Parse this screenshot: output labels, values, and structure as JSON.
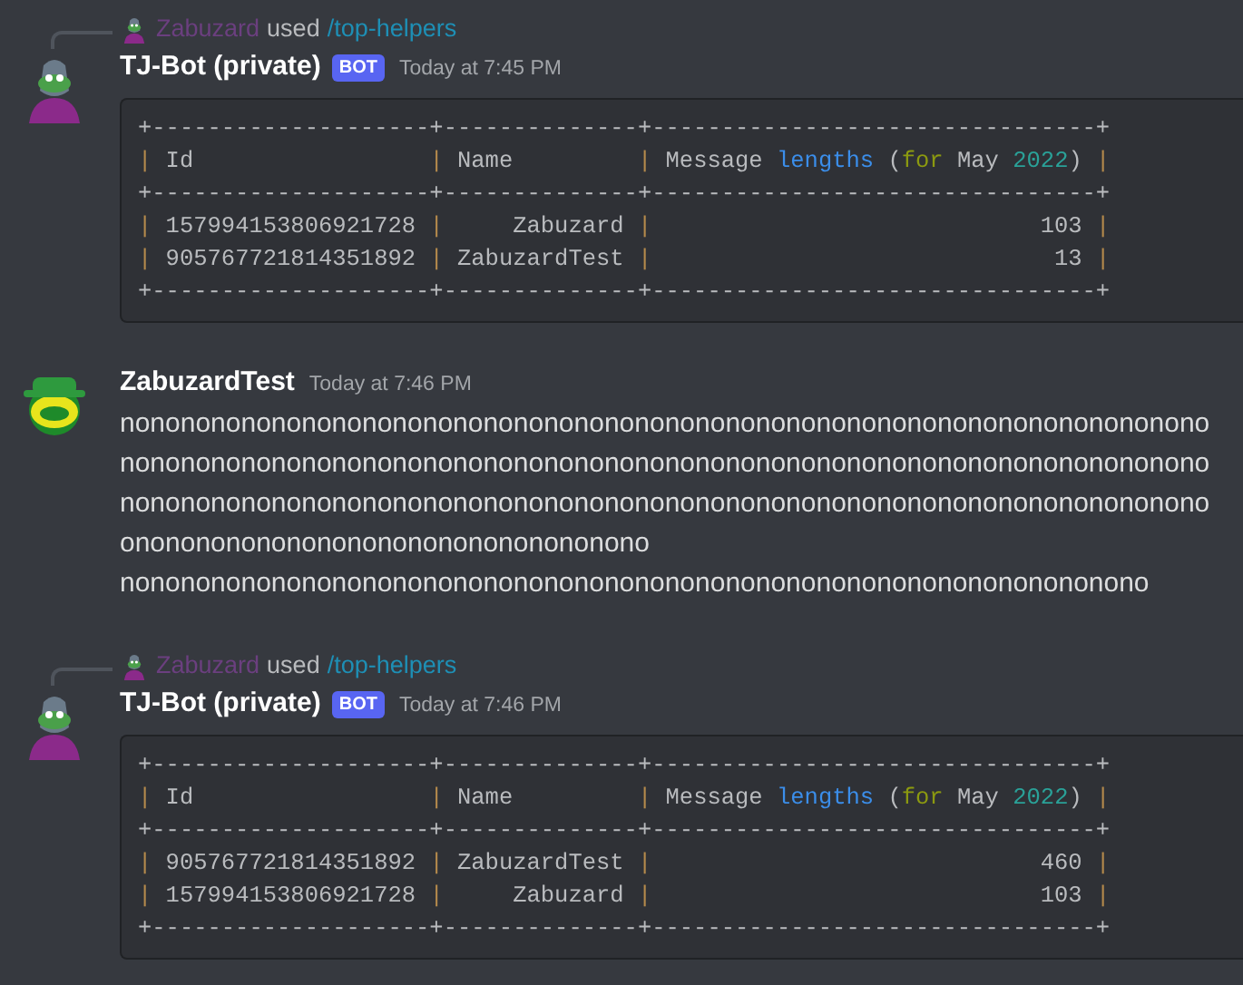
{
  "messages": [
    {
      "kind": "bot",
      "reply": {
        "user": "Zabuzard",
        "action": "used",
        "command": "/top-helpers"
      },
      "author": "TJ-Bot (private)",
      "tag": "BOT",
      "time": "Today at 7:45 PM",
      "code_lines": [
        [
          {
            "text": "+--------------------+--------------+--------------------------------+",
            "kind": "plain"
          }
        ],
        [
          {
            "text": "|",
            "kind": "pipe"
          },
          {
            "text": " Id                 ",
            "kind": "plain"
          },
          {
            "text": "|",
            "kind": "pipe"
          },
          {
            "text": " Name         ",
            "kind": "plain"
          },
          {
            "text": "|",
            "kind": "pipe"
          },
          {
            "text": " Message ",
            "kind": "plain"
          },
          {
            "text": "lengths",
            "kind": "function"
          },
          {
            "text": " (",
            "kind": "plain"
          },
          {
            "text": "for",
            "kind": "keyword"
          },
          {
            "text": " May ",
            "kind": "plain"
          },
          {
            "text": "2022",
            "kind": "number"
          },
          {
            "text": ") ",
            "kind": "plain"
          },
          {
            "text": "|",
            "kind": "pipe"
          }
        ],
        [
          {
            "text": "+--------------------+--------------+--------------------------------+",
            "kind": "plain"
          }
        ],
        [
          {
            "text": "|",
            "kind": "pipe"
          },
          {
            "text": " 157994153806921728 ",
            "kind": "plain"
          },
          {
            "text": "|",
            "kind": "pipe"
          },
          {
            "text": "     Zabuzard ",
            "kind": "plain"
          },
          {
            "text": "|",
            "kind": "pipe"
          },
          {
            "text": "                            103 ",
            "kind": "plain"
          },
          {
            "text": "|",
            "kind": "pipe"
          }
        ],
        [
          {
            "text": "|",
            "kind": "pipe"
          },
          {
            "text": " 905767721814351892 ",
            "kind": "plain"
          },
          {
            "text": "|",
            "kind": "pipe"
          },
          {
            "text": " ZabuzardTest ",
            "kind": "plain"
          },
          {
            "text": "|",
            "kind": "pipe"
          },
          {
            "text": "                             13 ",
            "kind": "plain"
          },
          {
            "text": "|",
            "kind": "pipe"
          }
        ],
        [
          {
            "text": "+--------------------+--------------+--------------------------------+",
            "kind": "plain"
          }
        ]
      ]
    },
    {
      "kind": "user",
      "author": "ZabuzardTest",
      "time": "Today at 7:46 PM",
      "text_lines": [
        "nononononononononononononononononononononononononononononononononononono",
        "nononononononononononononononononononononononononononononononononononono",
        "nononononononononononononononononononononononononononononononononononono",
        "ononononononononononononononononono",
        "nononononononononononononononononononononononononononononononononono"
      ]
    },
    {
      "kind": "bot",
      "reply": {
        "user": "Zabuzard",
        "action": "used",
        "command": "/top-helpers"
      },
      "author": "TJ-Bot (private)",
      "tag": "BOT",
      "time": "Today at 7:46 PM",
      "code_lines": [
        [
          {
            "text": "+--------------------+--------------+--------------------------------+",
            "kind": "plain"
          }
        ],
        [
          {
            "text": "|",
            "kind": "pipe"
          },
          {
            "text": " Id                 ",
            "kind": "plain"
          },
          {
            "text": "|",
            "kind": "pipe"
          },
          {
            "text": " Name         ",
            "kind": "plain"
          },
          {
            "text": "|",
            "kind": "pipe"
          },
          {
            "text": " Message ",
            "kind": "plain"
          },
          {
            "text": "lengths",
            "kind": "function"
          },
          {
            "text": " (",
            "kind": "plain"
          },
          {
            "text": "for",
            "kind": "keyword"
          },
          {
            "text": " May ",
            "kind": "plain"
          },
          {
            "text": "2022",
            "kind": "number"
          },
          {
            "text": ") ",
            "kind": "plain"
          },
          {
            "text": "|",
            "kind": "pipe"
          }
        ],
        [
          {
            "text": "+--------------------+--------------+--------------------------------+",
            "kind": "plain"
          }
        ],
        [
          {
            "text": "|",
            "kind": "pipe"
          },
          {
            "text": " 905767721814351892 ",
            "kind": "plain"
          },
          {
            "text": "|",
            "kind": "pipe"
          },
          {
            "text": " ZabuzardTest ",
            "kind": "plain"
          },
          {
            "text": "|",
            "kind": "pipe"
          },
          {
            "text": "                            460 ",
            "kind": "plain"
          },
          {
            "text": "|",
            "kind": "pipe"
          }
        ],
        [
          {
            "text": "|",
            "kind": "pipe"
          },
          {
            "text": " 157994153806921728 ",
            "kind": "plain"
          },
          {
            "text": "|",
            "kind": "pipe"
          },
          {
            "text": "     Zabuzard ",
            "kind": "plain"
          },
          {
            "text": "|",
            "kind": "pipe"
          },
          {
            "text": "                            103 ",
            "kind": "plain"
          },
          {
            "text": "|",
            "kind": "pipe"
          }
        ],
        [
          {
            "text": "+--------------------+--------------+--------------------------------+",
            "kind": "plain"
          }
        ]
      ]
    }
  ]
}
